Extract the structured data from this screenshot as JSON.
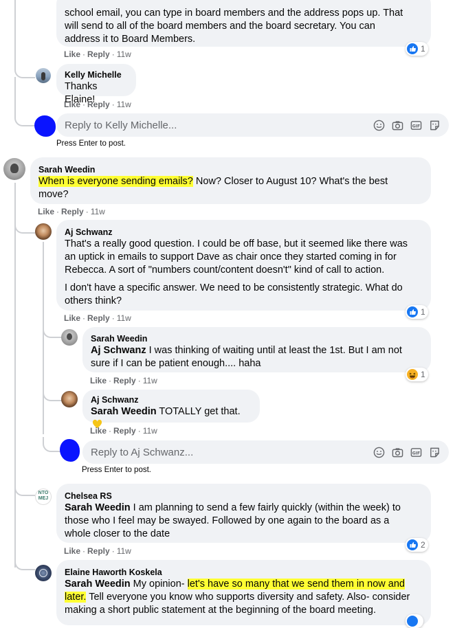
{
  "comments": {
    "c0": {
      "lines": [
        "school email, you can type in board members and the address pops up. That",
        "will send to all of the board members and the board secretary. You can",
        "address it to Board Members."
      ],
      "like": "Like",
      "reply": "Reply",
      "time": "11w",
      "reaction_count": "1"
    },
    "c1": {
      "author": "Kelly Michelle",
      "text": "Thanks Elaine!",
      "like": "Like",
      "reply": "Reply",
      "time": "11w"
    },
    "reply1": {
      "placeholder": "Reply to Kelly Michelle...",
      "hint": "Press Enter to post."
    },
    "c2": {
      "author": "Sarah Weedin",
      "highlight": "When is everyone sending emails?",
      "rest_line1": " Now? Closer to August 10? What's the best",
      "line2": "move?",
      "like": "Like",
      "reply": "Reply",
      "time": "11w"
    },
    "c3": {
      "author": "Aj Schwanz",
      "lines": [
        "That's a really good question. I could be off base, but it seemed like there was",
        "an uptick in emails to support Dave as chair once they started coming in for",
        "Rebecca. A sort of \"numbers count/content doesn't\" kind of call to action."
      ],
      "lines2": [
        "I don't have a specific answer. We need to be consistently strategic. What do",
        "others think?"
      ],
      "like": "Like",
      "reply": "Reply",
      "time": "11w",
      "reaction_count": "1"
    },
    "c4": {
      "author": "Sarah Weedin",
      "mention": "Aj Schwanz",
      "line1": " I was thinking of waiting until at least the 1st. But I am not",
      "line2": "sure if I can be patient enough.... haha",
      "like": "Like",
      "reply": "Reply",
      "time": "11w",
      "reaction_count": "1"
    },
    "c5": {
      "author": "Aj Schwanz",
      "mention": "Sarah Weedin",
      "text": " TOTALLY get that.",
      "like": "Like",
      "reply": "Reply",
      "time": "11w"
    },
    "reply2": {
      "placeholder": "Reply to Aj Schwanz...",
      "hint": "Press Enter to post."
    },
    "c6": {
      "author": "Chelsea RS",
      "mention": "Sarah Weedin",
      "line1": " I am planning to send a few fairly quickly (within the week) to",
      "line2": "those who I feel may be swayed. Followed by one again to the board as a",
      "line3": "whole closer to the date",
      "like": "Like",
      "reply": "Reply",
      "time": "11w",
      "reaction_count": "2",
      "avatar_text": "NTO MEJ"
    },
    "c7": {
      "author": "Elaine Haworth Koskela",
      "mention": "Sarah Weedin",
      "pre": " My opinion- ",
      "hl1": "let's have so many that we send them in now and",
      "hl2": "later.",
      "post": " Tell everyone you know who supports diversity and safety. Also- consider",
      "line3": "making a short public statement at the beginning of the board meeting."
    }
  },
  "colors": {
    "highlight": "#ffff33",
    "like_blue": "#1877f2",
    "bubble": "#f0f2f5",
    "redact": "#0a14ff"
  },
  "icons": [
    "emoji-icon",
    "camera-icon",
    "gif-icon",
    "sticker-icon",
    "like-icon",
    "haha-icon"
  ]
}
